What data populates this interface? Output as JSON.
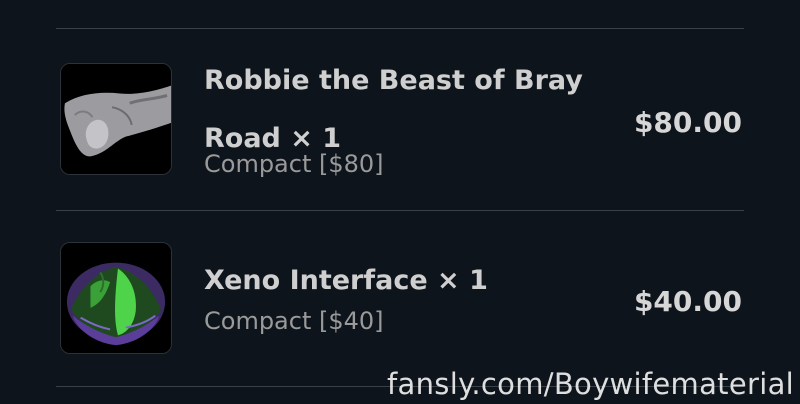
{
  "cart": {
    "items": [
      {
        "title": "Robbie the Beast of Bray Road × 1",
        "variant": "Compact [$80]",
        "price": "$80.00",
        "thumbnail_icon": "gray-sculpted-product-image"
      },
      {
        "title": "Xeno Interface × 1",
        "variant": "Compact [$40]",
        "price": "$40.00",
        "thumbnail_icon": "green-purple-sculpted-product-image"
      }
    ]
  },
  "watermark": "fansly.com/Boywifematerial",
  "colors": {
    "background": "#0d141b",
    "divider": "#3b4148",
    "title": "#cfcfcf",
    "variant": "#9a9a9a",
    "price": "#d6d6d6"
  }
}
